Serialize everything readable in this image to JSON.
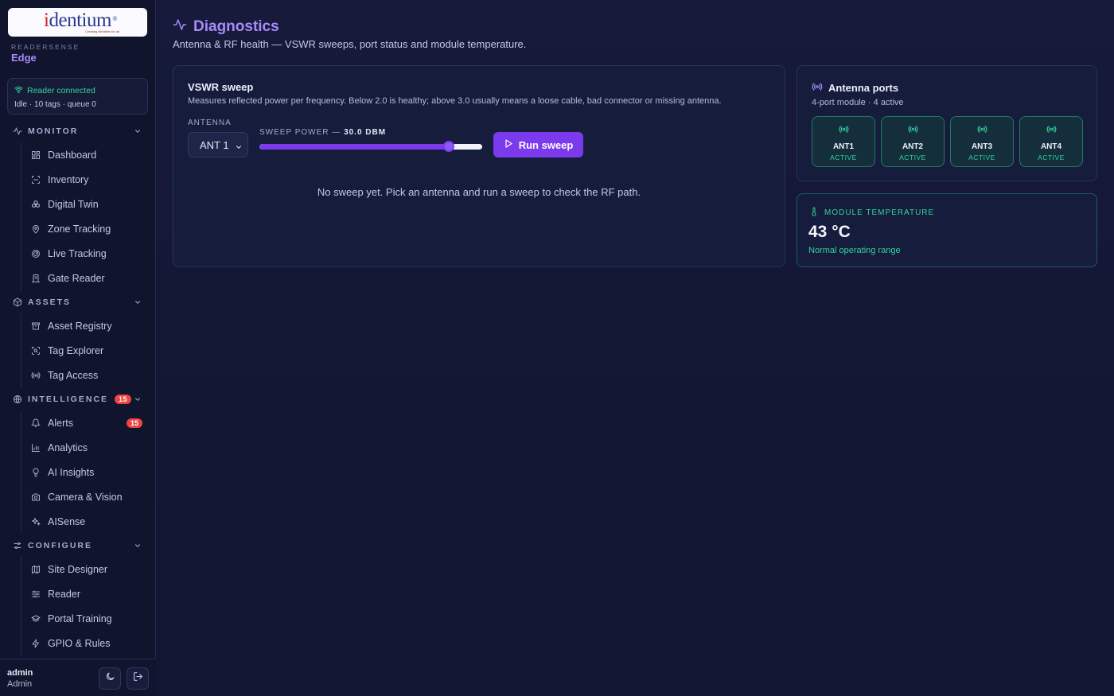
{
  "brand": {
    "logo_word": "identium",
    "logo_tagline": "Creating identities for all",
    "product_label": "READERSENSE",
    "edition": "Edge"
  },
  "connection": {
    "status": "Reader connected",
    "detail": "Idle · 10 tags · queue 0",
    "color": "#34d399"
  },
  "nav": {
    "monitor": {
      "label": "MONITOR",
      "items": [
        {
          "label": "Dashboard",
          "icon": "dashboard-icon"
        },
        {
          "label": "Inventory",
          "icon": "scan-icon"
        },
        {
          "label": "Digital Twin",
          "icon": "boxes-icon"
        },
        {
          "label": "Zone Tracking",
          "icon": "map-pin-icon"
        },
        {
          "label": "Live Tracking",
          "icon": "radar-icon"
        },
        {
          "label": "Gate Reader",
          "icon": "gate-icon"
        }
      ]
    },
    "assets": {
      "label": "ASSETS",
      "items": [
        {
          "label": "Asset Registry",
          "icon": "archive-icon"
        },
        {
          "label": "Tag Explorer",
          "icon": "scan-search-icon"
        },
        {
          "label": "Tag Access",
          "icon": "radio-icon"
        }
      ]
    },
    "intelligence": {
      "label": "INTELLIGENCE",
      "badge": "15",
      "items": [
        {
          "label": "Alerts",
          "icon": "bell-icon",
          "badge": "15"
        },
        {
          "label": "Analytics",
          "icon": "bar-chart-icon"
        },
        {
          "label": "AI Insights",
          "icon": "lightbulb-icon"
        },
        {
          "label": "Camera & Vision",
          "icon": "camera-icon"
        },
        {
          "label": "AISense",
          "icon": "sparkles-icon"
        }
      ]
    },
    "configure": {
      "label": "CONFIGURE",
      "items": [
        {
          "label": "Site Designer",
          "icon": "map-icon"
        },
        {
          "label": "Reader",
          "icon": "sliders-icon"
        },
        {
          "label": "Portal Training",
          "icon": "graduation-cap-icon"
        },
        {
          "label": "GPIO & Rules",
          "icon": "zap-icon"
        }
      ]
    }
  },
  "user": {
    "name": "admin",
    "role": "Admin"
  },
  "page": {
    "title": "Diagnostics",
    "subtitle": "Antenna & RF health — VSWR sweeps, port status and module temperature."
  },
  "vswr": {
    "title": "VSWR sweep",
    "description": "Measures reflected power per frequency. Below 2.0 is healthy; above 3.0 usually means a loose cable, bad connector or missing antenna.",
    "antenna_label": "ANTENNA",
    "antenna_value": "ANT 1",
    "power_label": "SWEEP POWER — ",
    "power_value": "30.0 DBM",
    "power_level": 0.85,
    "run_label": "Run sweep",
    "empty_message": "No sweep yet. Pick an antenna and run a sweep to check the RF path."
  },
  "ports": {
    "title": "Antenna ports",
    "subtitle": "4-port module · 4 active",
    "items": [
      {
        "name": "ANT1",
        "status": "ACTIVE"
      },
      {
        "name": "ANT2",
        "status": "ACTIVE"
      },
      {
        "name": "ANT3",
        "status": "ACTIVE"
      },
      {
        "name": "ANT4",
        "status": "ACTIVE"
      }
    ],
    "active_color": "#34d399"
  },
  "temperature": {
    "label": "MODULE TEMPERATURE",
    "value": "43 °C",
    "note": "Normal operating range"
  },
  "colors": {
    "accent": "#7c3aed",
    "title": "#a78bfa",
    "success": "#34d399",
    "badge": "#ef4444"
  }
}
